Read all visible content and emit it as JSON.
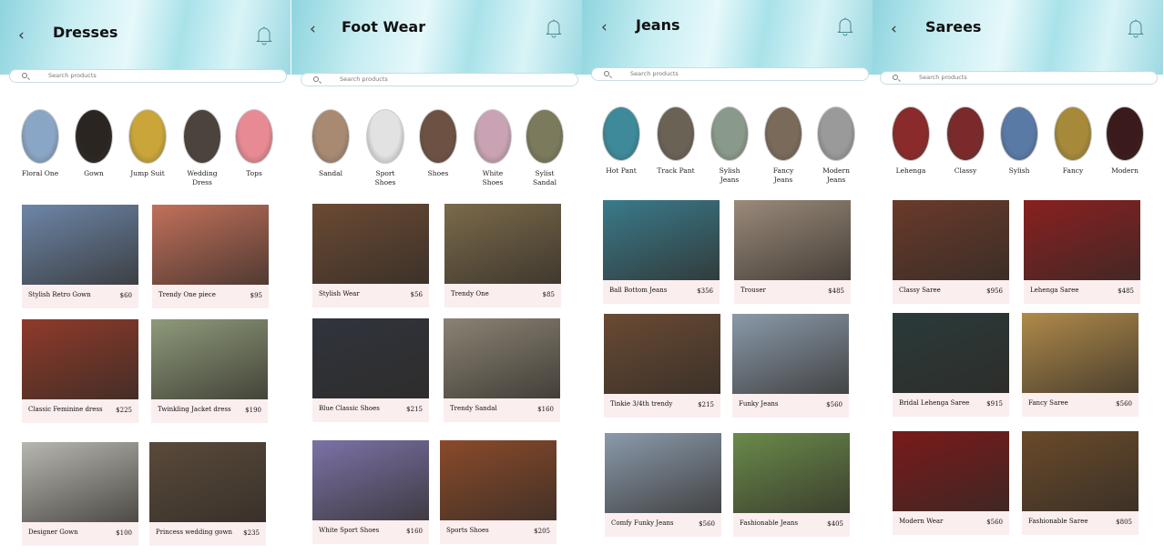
{
  "search_placeholder": "Search products",
  "panels": [
    {
      "title": "Dresses",
      "categories": [
        {
          "label": "Floral One",
          "color": "#8aa6c6"
        },
        {
          "label": "Gown",
          "color": "#2a2520"
        },
        {
          "label": "Jump Suit",
          "color": "#c9a53a"
        },
        {
          "label": "Wedding Dress",
          "color": "#4c443c"
        },
        {
          "label": "Tops",
          "color": "#e78a93"
        }
      ],
      "products": [
        {
          "name": "Stylish Retro Gown",
          "price": "$60",
          "color": "#6d86a8"
        },
        {
          "name": "Trendy One piece",
          "price": "$95",
          "color": "#c2705a"
        },
        {
          "name": "Classic Feminine dress",
          "price": "$225",
          "color": "#8f3a2a"
        },
        {
          "name": "Twinkling Jacket dress",
          "price": "$190",
          "color": "#8e9a7a"
        },
        {
          "name": "Designer Gown",
          "price": "$100",
          "color": "#b7b7b1"
        },
        {
          "name": "Princess  wedding  gown",
          "price": "$235",
          "color": "#5a4a3a"
        }
      ]
    },
    {
      "title": "Foot Wear",
      "categories": [
        {
          "label": "Sandal",
          "color": "#a88a72"
        },
        {
          "label": "Sport Shoes",
          "color": "#e2e2e2"
        },
        {
          "label": "Shoes",
          "color": "#6d5243"
        },
        {
          "label": "White Shoes",
          "color": "#c9a3b3"
        },
        {
          "label": "Sylist Sandal",
          "color": "#7b7a5c"
        }
      ],
      "products": [
        {
          "name": "Stylish Wear",
          "price": "$56",
          "color": "#6b4a33"
        },
        {
          "name": "Trendy One",
          "price": "$85",
          "color": "#7b6a4a"
        },
        {
          "name": "Blue Classic Shoes",
          "price": "$215",
          "color": "#30343e"
        },
        {
          "name": "Trendy Sandal",
          "price": "$160",
          "color": "#8a8374"
        },
        {
          "name": "White Sport Shoes",
          "price": "$160",
          "color": "#7b72a6"
        },
        {
          "name": "Sports Shoes",
          "price": "$205",
          "color": "#8a4a2a"
        }
      ]
    },
    {
      "title": "Jeans",
      "categories": [
        {
          "label": "Hot Pant",
          "color": "#3e8a9a"
        },
        {
          "label": "Track Pant",
          "color": "#6b6256"
        },
        {
          "label": "Sylish Jeans",
          "color": "#8a9a8a"
        },
        {
          "label": "Fancy Jeans",
          "color": "#7a6a5a"
        },
        {
          "label": "Modern Jeans",
          "color": "#9a9a9a"
        }
      ],
      "products": [
        {
          "name": "Ball Bottom Jeans",
          "price": "$356",
          "color": "#3a7a8a"
        },
        {
          "name": "Trouser",
          "price": "$485",
          "color": "#9a8a7a"
        },
        {
          "name": "Tinkie  3/4th trendy",
          "price": "$215",
          "color": "#6a4a33"
        },
        {
          "name": "Funky Jeans",
          "price": "$560",
          "color": "#8a9aaa"
        },
        {
          "name": "Comfy Funky Jeans",
          "price": "$560",
          "color": "#8a9aab"
        },
        {
          "name": "Fashionable Jeans",
          "price": "$405",
          "color": "#6a8a4a"
        }
      ]
    },
    {
      "title": "Sarees",
      "categories": [
        {
          "label": "Lehenga",
          "color": "#8a2a2a"
        },
        {
          "label": "Classy",
          "color": "#7a2a2a"
        },
        {
          "label": "Sylish",
          "color": "#5a7aa6"
        },
        {
          "label": "Fancy",
          "color": "#a68a3a"
        },
        {
          "label": "Modern",
          "color": "#3a1a1a"
        }
      ],
      "products": [
        {
          "name": "Classy Saree",
          "price": "$956",
          "color": "#6a3a2a"
        },
        {
          "name": "Lehenga Saree",
          "price": "$485",
          "color": "#8a2020"
        },
        {
          "name": "Bridal  Lehenga Saree",
          "price": "$915",
          "color": "#2a3a3a"
        },
        {
          "name": "Fancy Saree",
          "price": "$560",
          "color": "#b08a4a"
        },
        {
          "name": "Modern Wear",
          "price": "$560",
          "color": "#7a1a1a"
        },
        {
          "name": "Fashionable  Saree",
          "price": "$805",
          "color": "#6a4a2a"
        }
      ]
    }
  ]
}
